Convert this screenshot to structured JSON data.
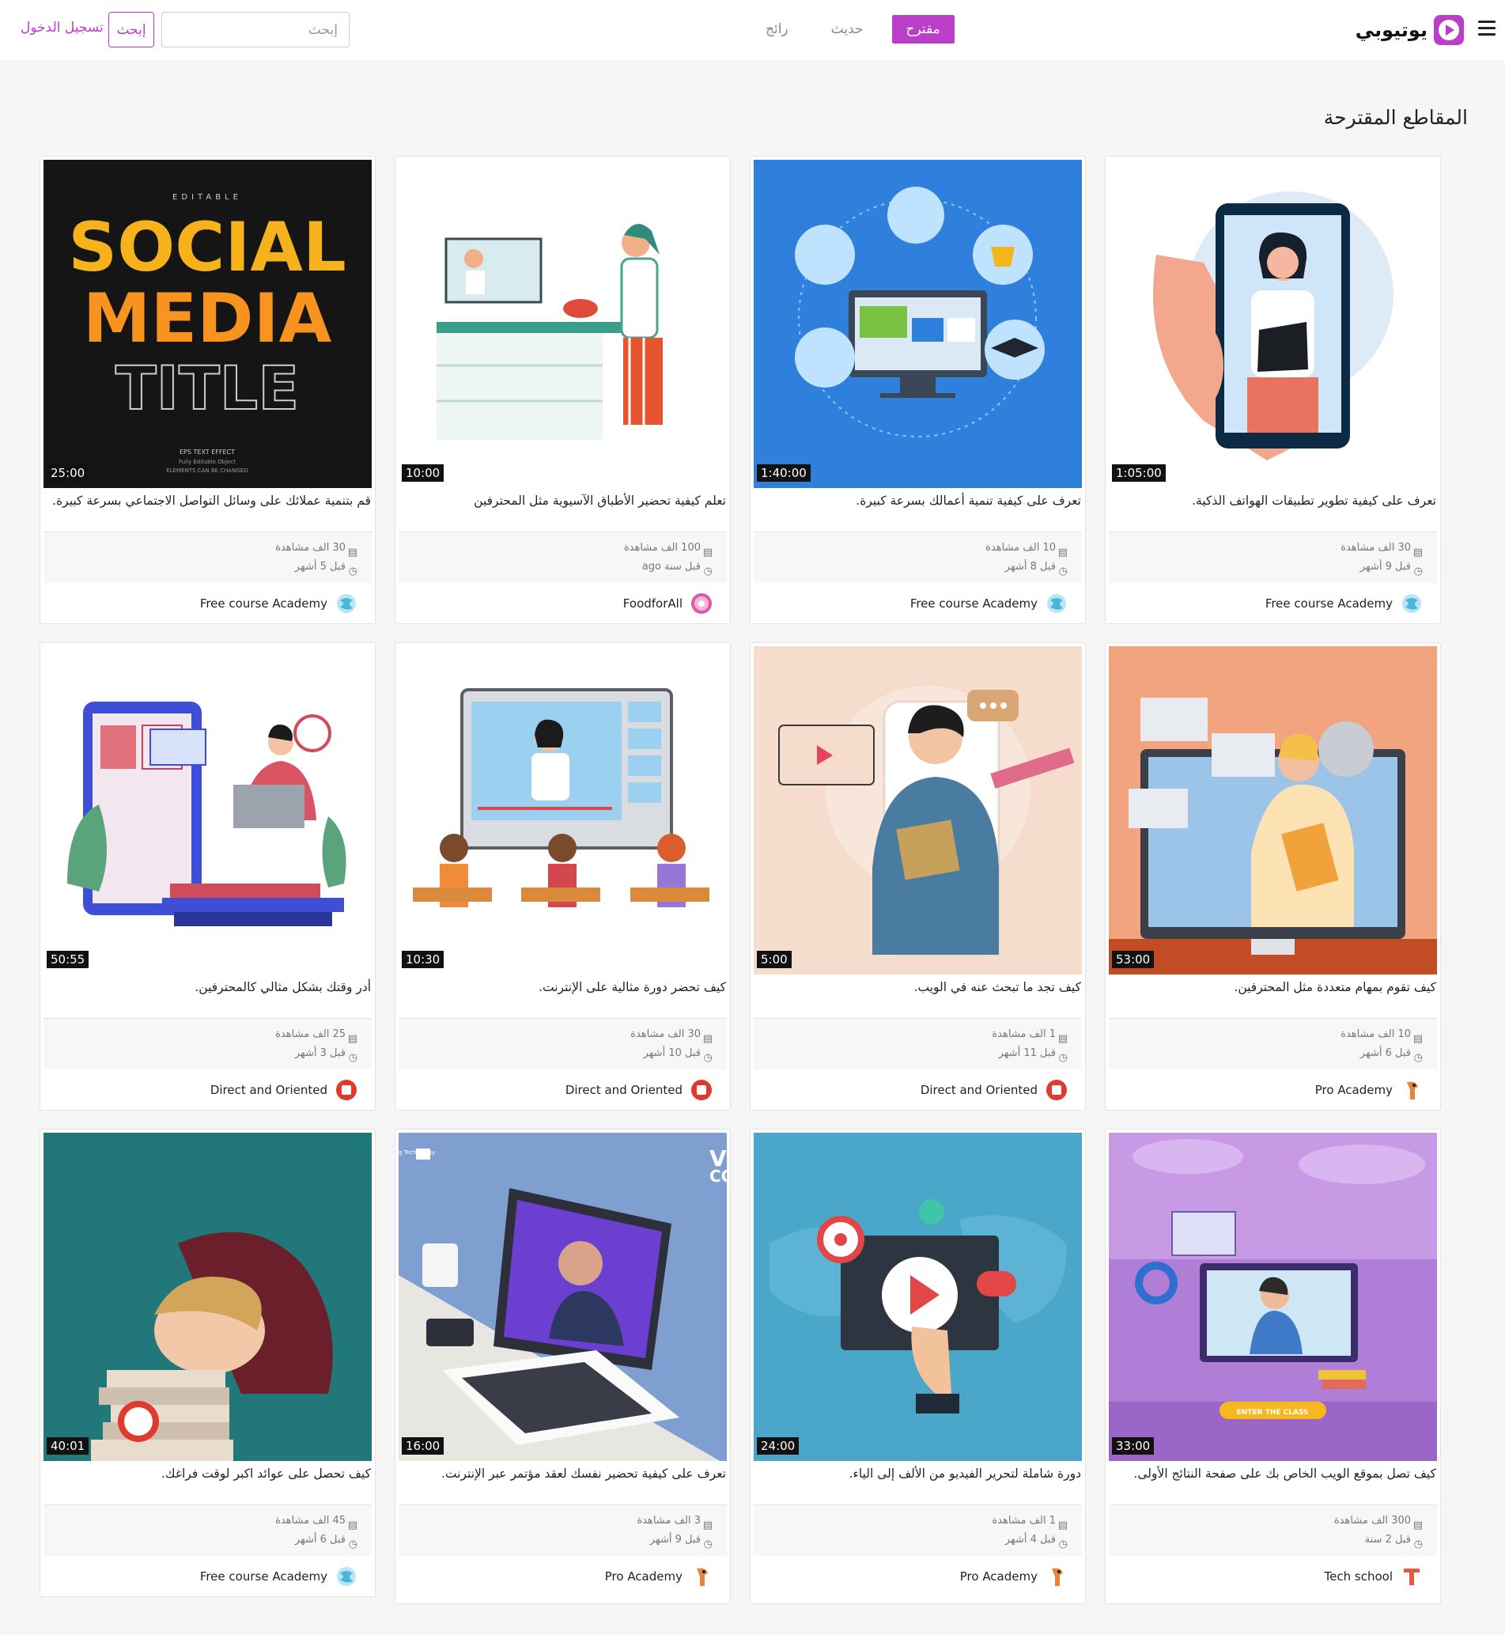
{
  "app": {
    "name": "يوتيوبي",
    "brand_color": "#bb3ec9"
  },
  "nav": {
    "tabs": [
      {
        "label": "مقترح",
        "active": true
      },
      {
        "label": "حديث",
        "active": false
      },
      {
        "label": "رائج",
        "active": false
      }
    ],
    "search_placeholder": "إبحث",
    "search_button": "إبحث",
    "login": "تسجيل الدخول"
  },
  "section": {
    "title": "المقاطع المقترحة"
  },
  "videos": [
    {
      "title": "تعرف على كيفية تطوير تطبيقات الهواتف الذكية.",
      "duration": "1:05:00",
      "views": "30 الف مشاهدة",
      "time": "قبل 9 أشهر",
      "channel": "Free course Academy",
      "thumb": "phone-teacher-thumbnail"
    },
    {
      "title": "تعرف على كيفية تنمية أعمالك بسرعة كبيرة.",
      "duration": "1:40:00",
      "views": "10 الف مشاهدة",
      "time": "قبل 8 أشهر",
      "channel": "Free course Academy",
      "thumb": "online-education-thumbnail"
    },
    {
      "title": "تعلم كيفية تحضير الأطباق الآسيوية مثل المحترفين",
      "duration": "10:00",
      "views": "100 الف مشاهدة",
      "time": "قبل سنة ago",
      "channel": "FoodforAll",
      "thumb": "cooking-thumbnail"
    },
    {
      "title": "قم بتنمية عملائك على وسائل التواصل الاجتماعي بسرعة كبيرة.",
      "duration": "25:00",
      "views": "30 الف مشاهدة",
      "time": "قبل 5 أشهر",
      "channel": "Free course Academy",
      "thumb": "social-media-title-thumbnail",
      "thumb_text": {
        "top": "EDITABLE",
        "line1": "SOCIAL",
        "line2": "MEDIA",
        "line3": "TITLE",
        "small1": "EPS TEXT EFFECT",
        "small2": "Fully Editable Object",
        "small3": "ELEMENTS CAN BE CHANGED"
      }
    },
    {
      "title": "كيف تقوم بمهام متعددة مثل المحترفين.",
      "duration": "53:00",
      "views": "10 الف مشاهدة",
      "time": "قبل 6 أشهر",
      "channel": "Pro Academy",
      "thumb": "multitask-thumbnail"
    },
    {
      "title": "كيف تجد ما تبحث عنه في الويب.",
      "duration": "5:00",
      "views": "1 الف مشاهدة",
      "time": "قبل 11 أشهر",
      "channel": "Direct and Oriented",
      "thumb": "web-search-thumbnail"
    },
    {
      "title": "كيف تحضر دورة مثالية على الإنترنت.",
      "duration": "10:30",
      "views": "30 الف مشاهدة",
      "time": "قبل 10 أشهر",
      "channel": "Direct and Oriented",
      "thumb": "online-class-thumbnail"
    },
    {
      "title": "أدر وقتك بشكل مثالي كالمحترفين.",
      "duration": "50:55",
      "views": "25 الف مشاهدة",
      "time": "قبل 3 أشهر",
      "channel": "Direct and Oriented",
      "thumb": "time-management-thumbnail"
    },
    {
      "title": "كيف تصل بموقع الويب الخاص بك على صفحة النتائج الأولى.",
      "duration": "33:00",
      "views": "300 الف مشاهدة",
      "time": "قبل 2 سنة",
      "channel": "Tech school",
      "thumb": "enter-class-thumbnail",
      "thumb_text": {
        "button": "ENTER THE CLASS"
      }
    },
    {
      "title": "دورة شاملة لتحرير الفيديو من الألف إلى الياء.",
      "duration": "24:00",
      "views": "1 الف مشاهدة",
      "time": "قبل 4 أشهر",
      "channel": "Pro Academy",
      "thumb": "video-editing-thumbnail"
    },
    {
      "title": "تعرف على كيفية تحضير نفسك لعقد مؤتمر عبر الإنترنت.",
      "duration": "16:00",
      "views": "3 الف مشاهدة",
      "time": "قبل 9 أشهر",
      "channel": "Pro Academy",
      "thumb": "video-conference-thumbnail",
      "thumb_text": {
        "line1": "VIDEO",
        "line2": "CONFERENCE",
        "badge": "Online Meeting Technology"
      }
    },
    {
      "title": "كيف تحصل على عوائد اكبر لوقت فراغك.",
      "duration": "40:01",
      "views": "45 الف مشاهدة",
      "time": "قبل 6 أشهر",
      "channel": "Free course Academy",
      "thumb": "sleeping-boy-thumbnail"
    }
  ]
}
